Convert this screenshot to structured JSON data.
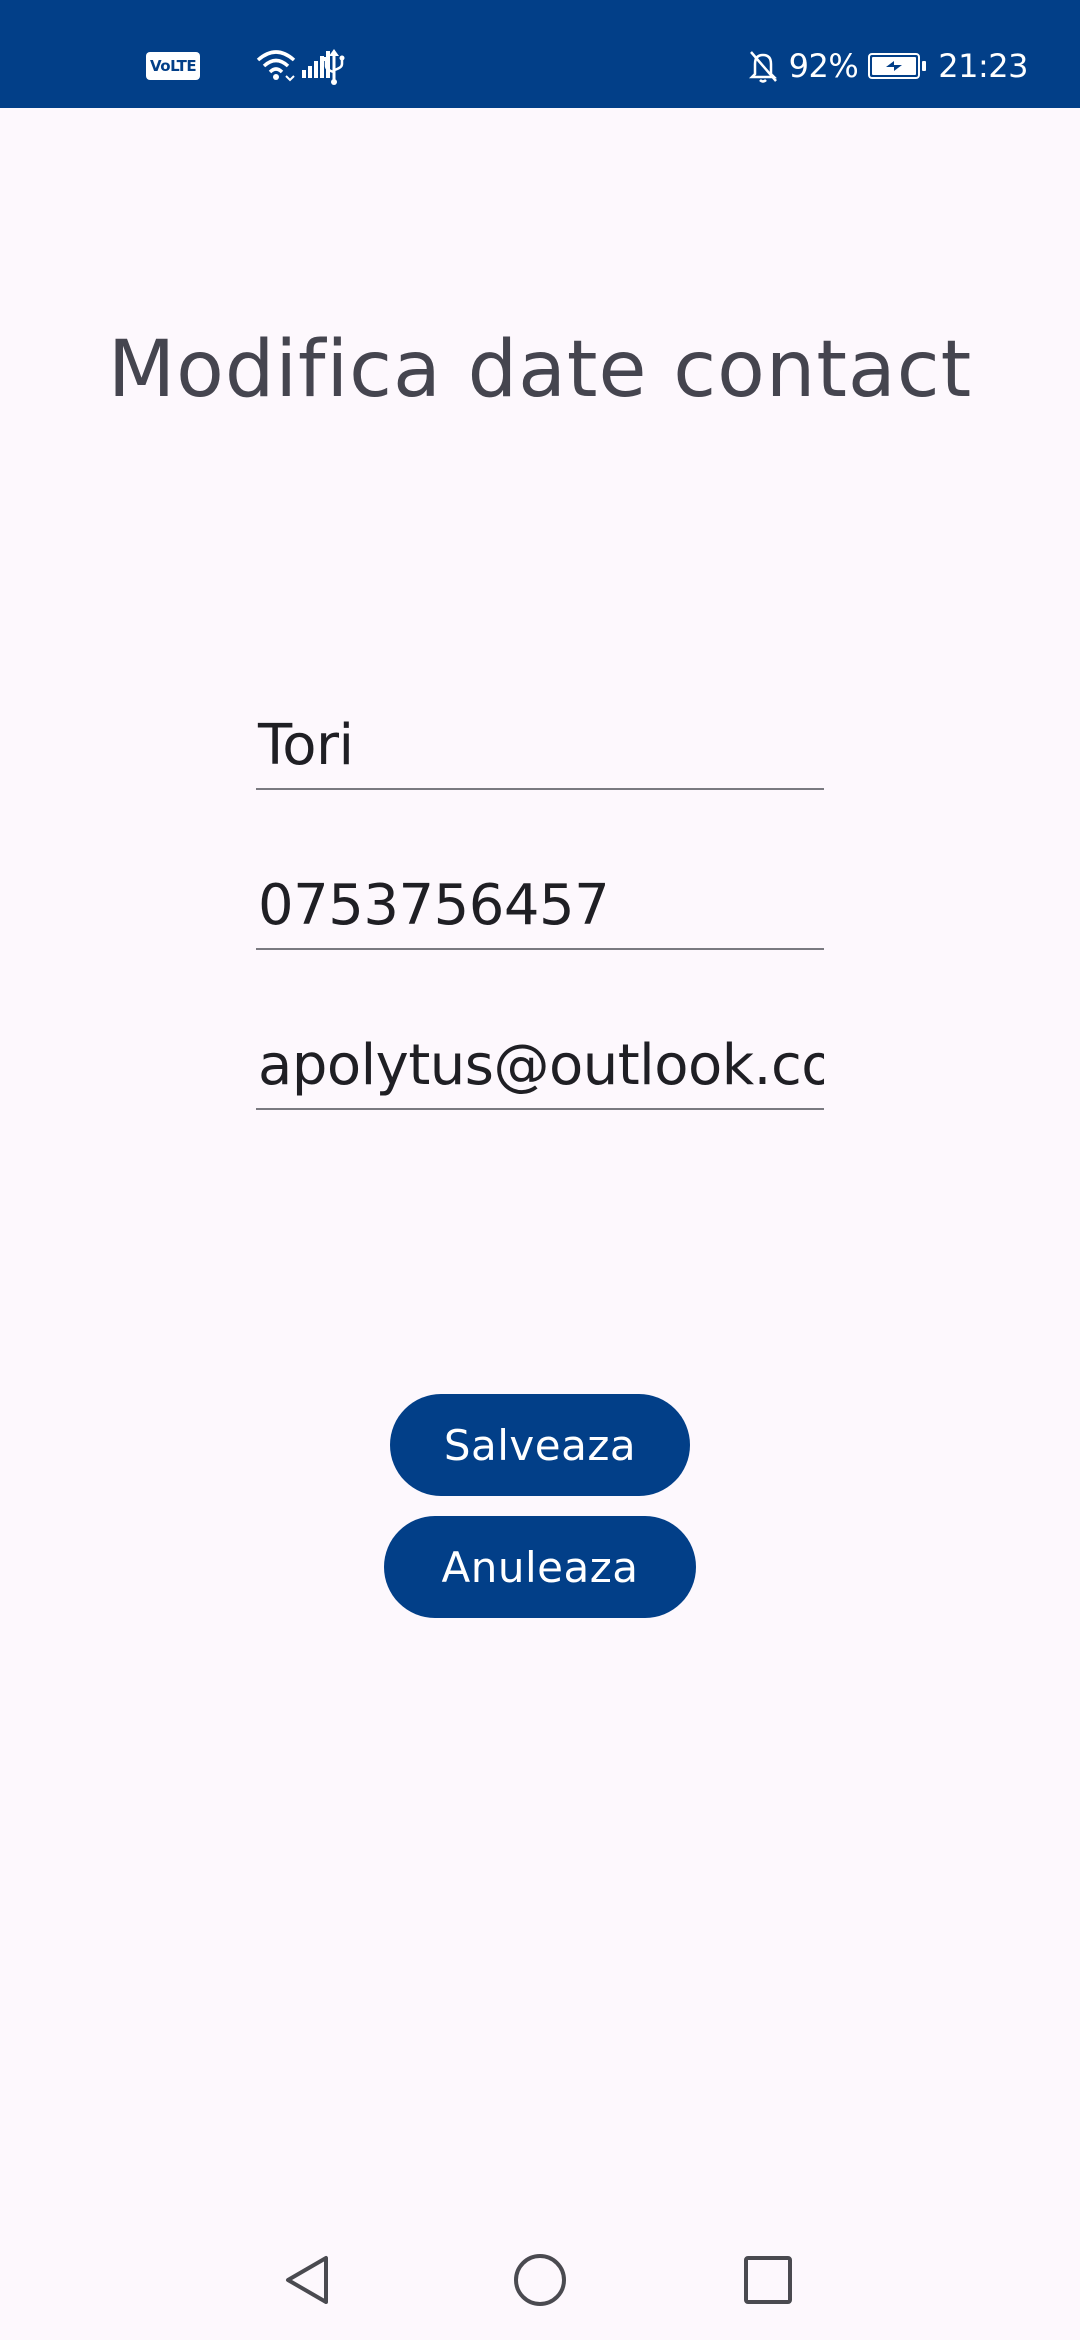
{
  "status_bar": {
    "network_badge": "VoLTE",
    "battery_percent": "92%",
    "battery_level": 0.92,
    "time": "21:23",
    "icons": [
      "signal-icon",
      "wifi-icon",
      "usb-icon",
      "bell-off-icon",
      "battery-charging-icon"
    ]
  },
  "page": {
    "title": "Modifica date contact"
  },
  "form": {
    "name_value": "Tori",
    "phone_value": "0753756457",
    "email_value": "apolytus@outlook.com"
  },
  "actions": {
    "save_label": "Salveaza",
    "cancel_label": "Anuleaza"
  },
  "navigation": {
    "icons": [
      "back-icon",
      "home-icon",
      "recent-apps-icon"
    ]
  },
  "colors": {
    "primary": "#023f88",
    "background": "#fdf8fd",
    "title_text": "#45454f",
    "field_text": "#1f1f24"
  }
}
